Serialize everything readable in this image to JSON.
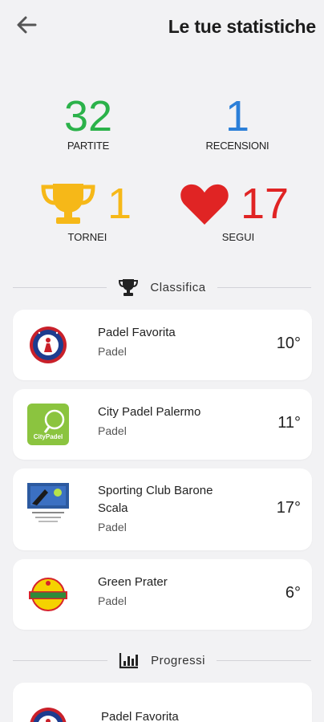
{
  "header": {
    "title": "Le tue statistiche",
    "back_icon": "arrow-left-icon"
  },
  "stats": {
    "partite": {
      "value": "32",
      "label": "PARTITE",
      "color": "#2bb24a"
    },
    "recensioni": {
      "value": "1",
      "label": "RECENSIONI",
      "color": "#2b7fd8"
    },
    "tornei": {
      "value": "1",
      "label": "TORNEI",
      "color": "#f6b818",
      "icon": "trophy-icon"
    },
    "segui": {
      "value": "17",
      "label": "SEGUI",
      "color": "#e02424",
      "icon": "heart-icon"
    }
  },
  "sections": {
    "classifica": {
      "label": "Classifica",
      "icon": "trophy-icon"
    },
    "progressi": {
      "label": "Progressi",
      "icon": "bar-chart-icon"
    }
  },
  "ranking": [
    {
      "name": "Padel Favorita",
      "sport": "Padel",
      "rank": "10°"
    },
    {
      "name": "City Padel Palermo",
      "sport": "Padel",
      "rank": "11°"
    },
    {
      "name": "Sporting Club Barone Scala",
      "sport": "Padel",
      "rank": "17°"
    },
    {
      "name": "Green Prater",
      "sport": "Padel",
      "rank": "6°"
    }
  ],
  "progress": [
    {
      "name": "Padel Favorita"
    }
  ],
  "logos": {
    "city_padel_text": "CityPadel"
  }
}
